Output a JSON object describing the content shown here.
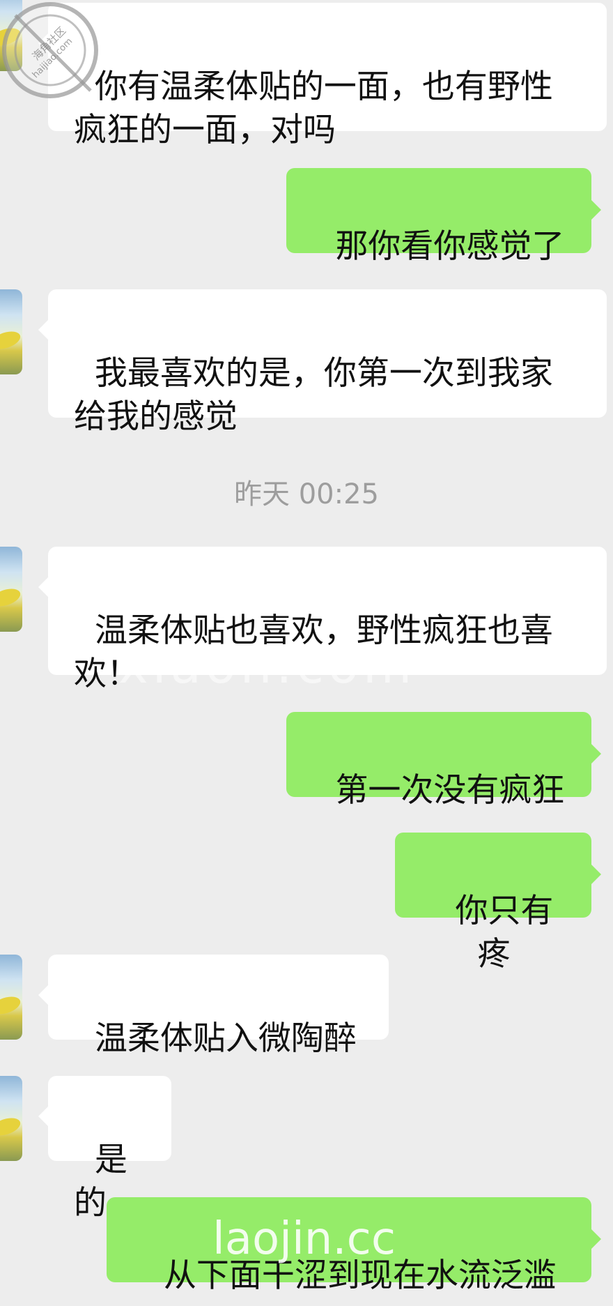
{
  "chat": {
    "messages": [
      {
        "side": "in",
        "text": "你有温柔体贴的一面，也有野性疯狂的一面，对吗"
      },
      {
        "side": "out",
        "text": "那你看你感觉了"
      },
      {
        "side": "in",
        "text": "我最喜欢的是，你第一次到我家给我的感觉"
      },
      {
        "side": "in",
        "text": "温柔体贴也喜欢，野性疯狂也喜欢！"
      },
      {
        "side": "out",
        "text": "第一次没有疯狂"
      },
      {
        "side": "out",
        "text": "你只有疼"
      },
      {
        "side": "in",
        "text": "温柔体贴入微陶醉"
      },
      {
        "side": "in",
        "text": "是的"
      },
      {
        "side": "out",
        "text": "从下面干涩到现在水流泛滥"
      }
    ],
    "timestamp": "昨天 00:25"
  },
  "watermarks": {
    "seal_line1": "海角社区",
    "seal_line2": "haijiao.com",
    "middle": "xiaoh.com",
    "bottom": "laojin.cc"
  },
  "colors": {
    "background": "#ededed",
    "incoming_bubble": "#ffffff",
    "outgoing_bubble": "#95ec69",
    "timestamp": "#9d9d9d"
  }
}
